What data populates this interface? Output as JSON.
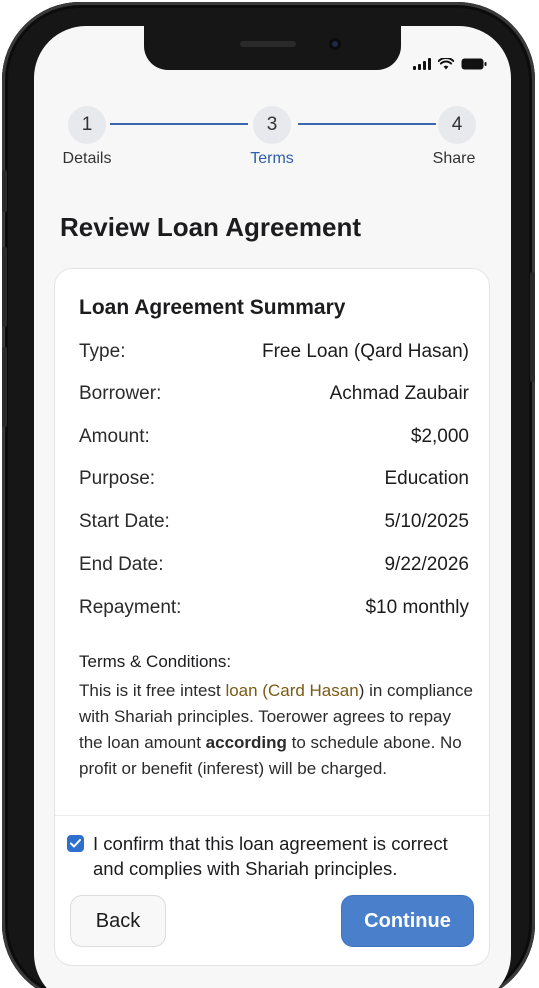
{
  "stepper": {
    "steps": [
      {
        "number": "1",
        "label": "Details"
      },
      {
        "number": "3",
        "label": "Terms"
      },
      {
        "number": "4",
        "label": "Share"
      }
    ],
    "active_color": "#2f5fa7"
  },
  "page": {
    "title": "Review Loan Agreement"
  },
  "summary": {
    "title": "Loan Agreement Summary",
    "rows": [
      {
        "label": "Type:",
        "value": "Free Loan (Qard Hasan)"
      },
      {
        "label": "Borrower:",
        "value": "Achmad Zaubair"
      },
      {
        "label": "Amount:",
        "value": "$2,000"
      },
      {
        "label": "Purpose:",
        "value": "Education"
      },
      {
        "label": "Start Date:",
        "value": "5/10/2025"
      },
      {
        "label": "End Date:",
        "value": "9/22/2026"
      },
      {
        "label": "Repayment:",
        "value": "$10 monthly"
      }
    ]
  },
  "terms": {
    "heading": "Terms & Conditions:",
    "body_part1": "This is it free intest ",
    "body_highlight": "loan (Card Hasan",
    "body_part2": ") in compliance with Shariah principles. Toerower agrees to repay the loan amount ",
    "body_bold": "according",
    "body_part3": " to schedule abone. No profit or benefit (inferest) will be charged."
  },
  "confirm": {
    "checked": true,
    "text": "I confirm that this loan agreement is correct and complies with Shariah principles."
  },
  "actions": {
    "back_label": "Back",
    "continue_label": "Continue"
  },
  "icons": [
    "signal-icon",
    "wifi-icon",
    "battery-icon",
    "checkmark-icon"
  ],
  "colors": {
    "accent": "#4a7fcc",
    "checkbox": "#2f6fce",
    "background": "#f7f7f8"
  }
}
